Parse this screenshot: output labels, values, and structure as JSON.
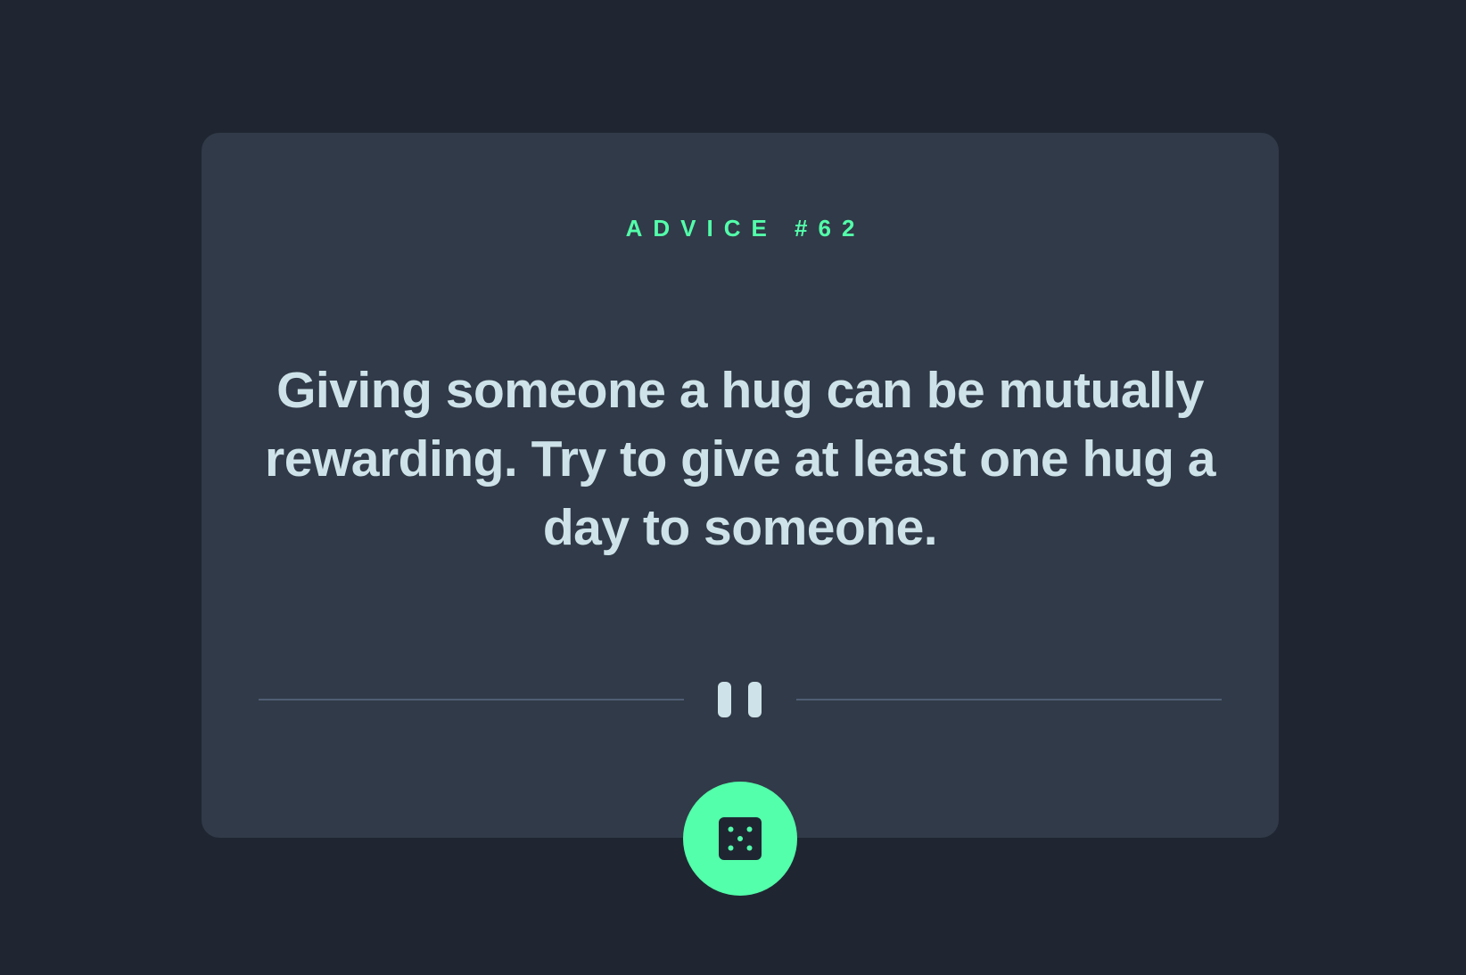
{
  "card": {
    "advice_label": "ADVICE #62",
    "quote": "Giving someone a hug can be mutually rewarding. Try to give at least one hug a day to someone."
  },
  "icons": {
    "divider": "pause-icon",
    "button": "dice-icon"
  },
  "colors": {
    "background": "#1f2632",
    "card": "#313a48",
    "accent": "#53ffaa",
    "text": "#cee3e9",
    "divider": "#4f5d74"
  }
}
